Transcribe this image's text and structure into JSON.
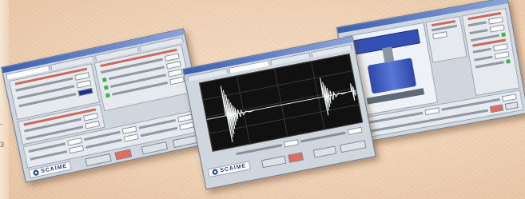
{
  "brand": {
    "logo_text": "SCAIME",
    "colors": {
      "logo": "#1d3f88",
      "indicator": "#3fb24a",
      "alert": "#e56b5d",
      "title_bar": "#3c5fb2"
    }
  },
  "left_margin": {
    "glyph_top": "-",
    "glyph_bottom": "3"
  },
  "windows": [
    {
      "name": "parameters-window",
      "content": "settings form with red-titled parameter panels, numeric fields and green status indicators"
    },
    {
      "name": "graph-window",
      "content": "signal plot on black background with two decaying oscillation bursts"
    },
    {
      "name": "press-window",
      "content": "schematic of a press with blue cylinder and side panels of settings"
    }
  ],
  "icons": [
    "scaime-logo-icon"
  ]
}
